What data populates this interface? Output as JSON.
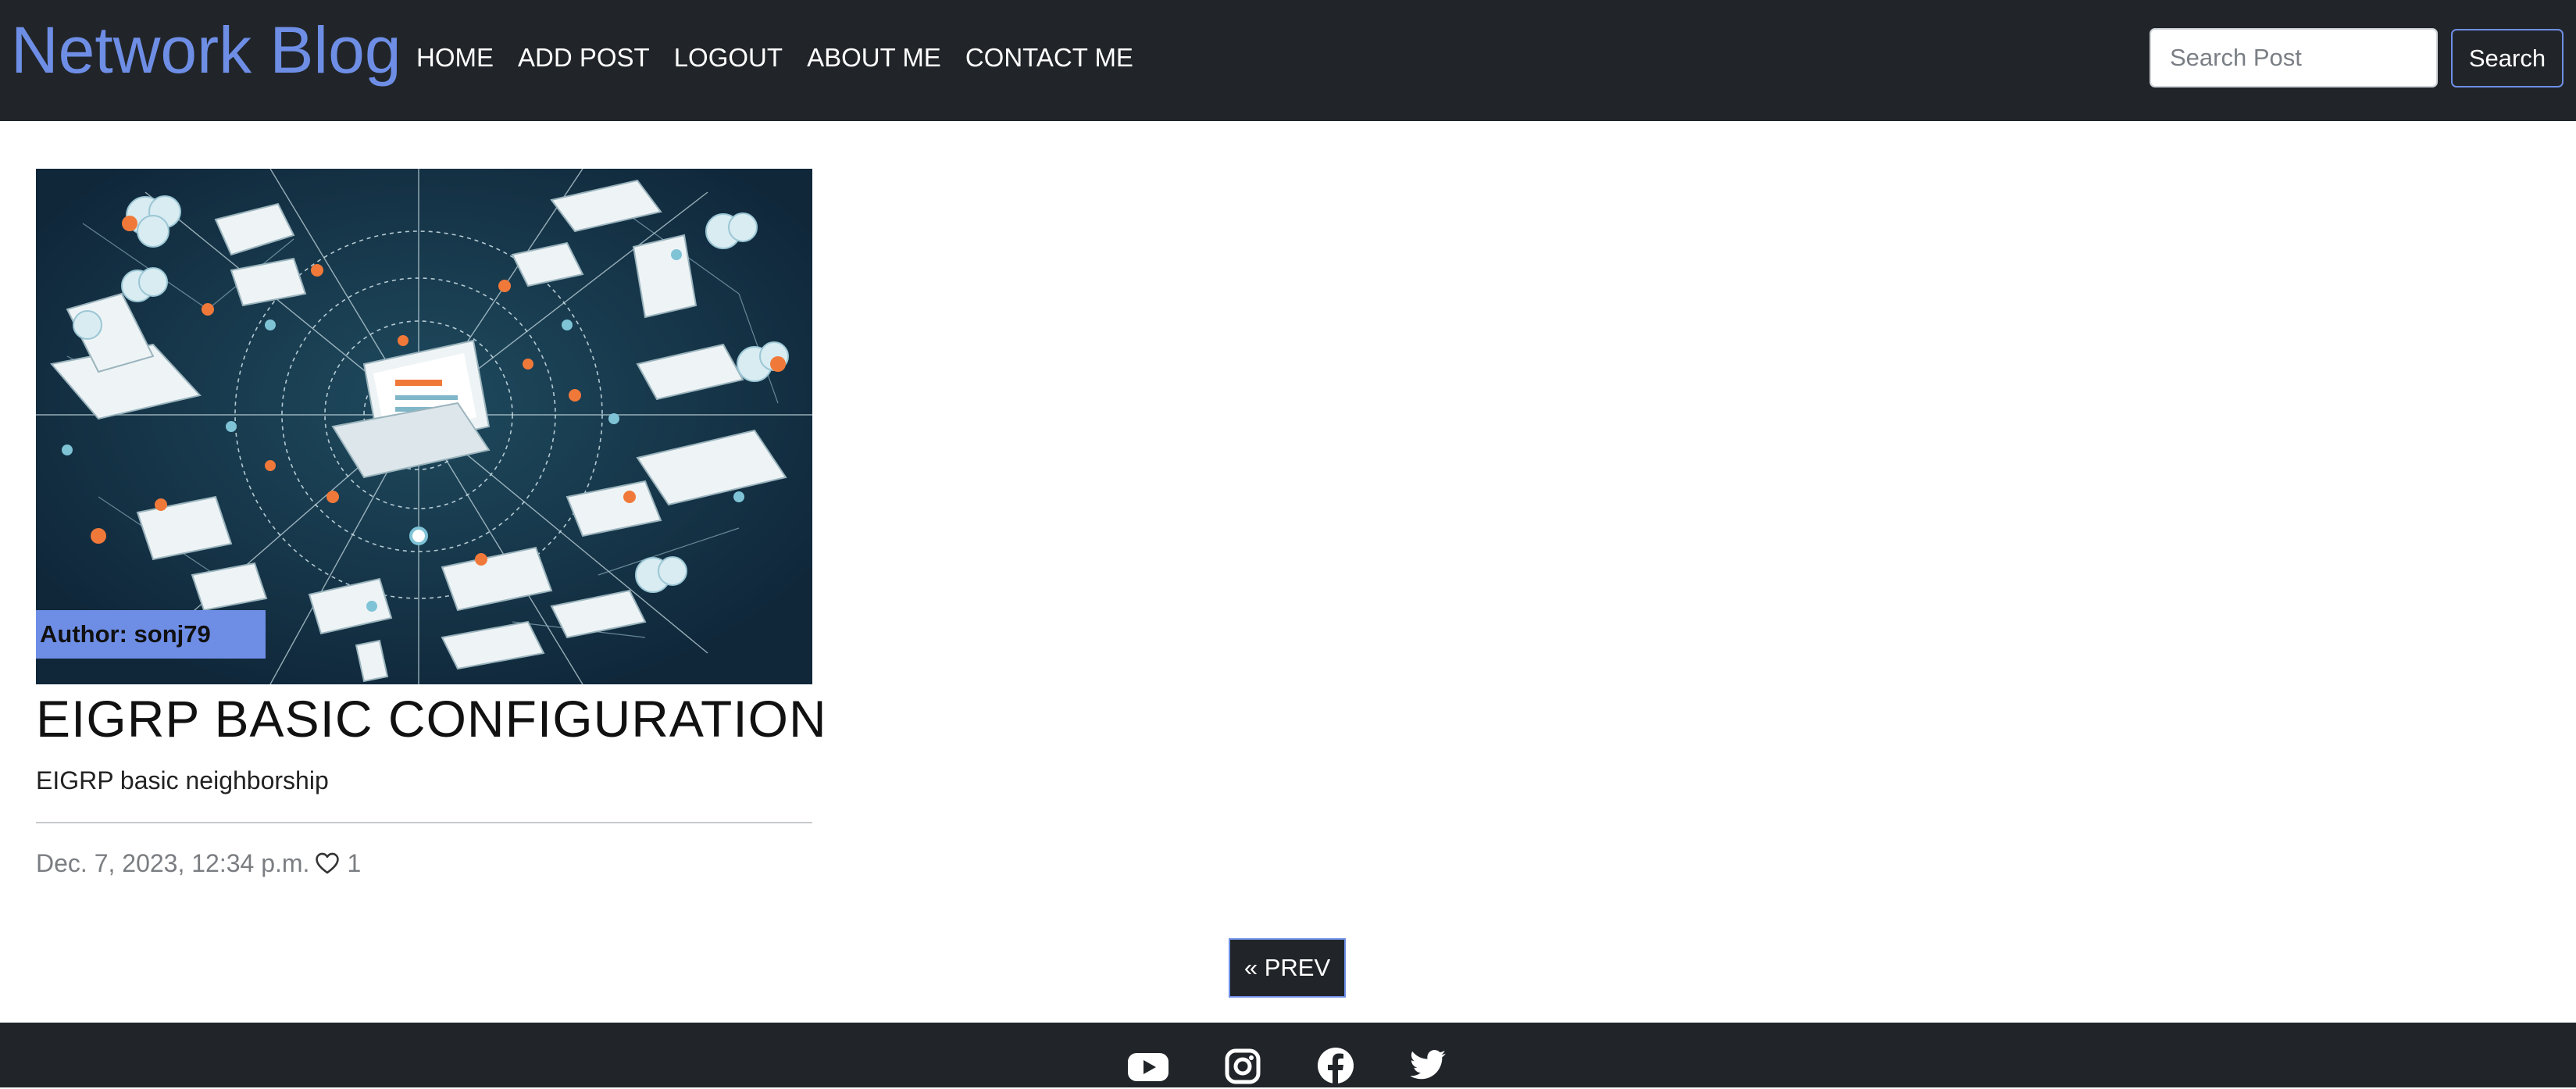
{
  "navbar": {
    "brand": "Network Blog",
    "links": [
      "HOME",
      "ADD POST",
      "LOGOUT",
      "ABOUT ME",
      "CONTACT ME"
    ],
    "search": {
      "placeholder": "Search Post",
      "value": "",
      "button_label": "Search"
    }
  },
  "post": {
    "author_label": "Author: sonj79",
    "title": "EIGRP BASIC CONFIGURATION",
    "summary": "EIGRP basic neighborship",
    "date": "Dec. 7, 2023, 12:34 p.m.",
    "likes": "1",
    "image_icon": "network-illustration"
  },
  "pagination": {
    "prev_label": "« PREV"
  },
  "footer": {
    "social_icons": [
      "youtube-icon",
      "instagram-icon",
      "facebook-icon",
      "twitter-icon"
    ]
  },
  "colors": {
    "navbar_bg": "#212529",
    "accent": "#6e8ee6",
    "text_muted": "#7a7d81"
  }
}
